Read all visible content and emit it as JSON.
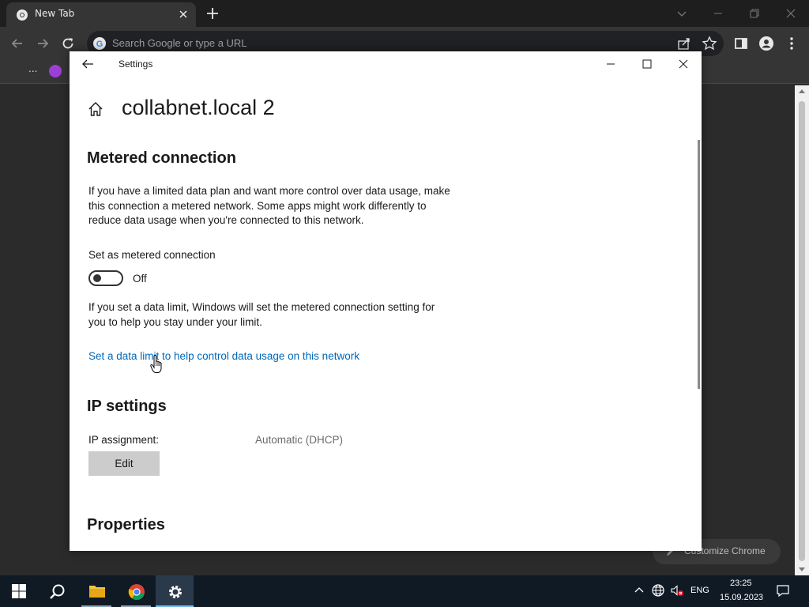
{
  "chrome": {
    "tab_title": "New Tab",
    "omnibox_placeholder": "Search Google or type a URL",
    "bookmarks_overflow": "...",
    "customize_label": "Customize Chrome"
  },
  "settings": {
    "window_title": "Settings",
    "heading": "collabnet.local 2",
    "metered": {
      "title": "Metered connection",
      "description": "If you have a limited data plan and want more control over data usage, make this connection a metered network. Some apps might work differently to reduce data usage when you're connected to this network.",
      "toggle_label": "Set as metered connection",
      "toggle_state": "Off",
      "limit_note": "If you set a data limit, Windows will set the metered connection setting for you to help you stay under your limit.",
      "limit_link": "Set a data limit to help control data usage on this network"
    },
    "ip": {
      "title": "IP settings",
      "assignment_label": "IP assignment:",
      "assignment_value": "Automatic (DHCP)",
      "edit_label": "Edit"
    },
    "properties": {
      "title": "Properties"
    }
  },
  "taskbar": {
    "language": "ENG",
    "time": "23:25",
    "date": "15.09.2023"
  }
}
